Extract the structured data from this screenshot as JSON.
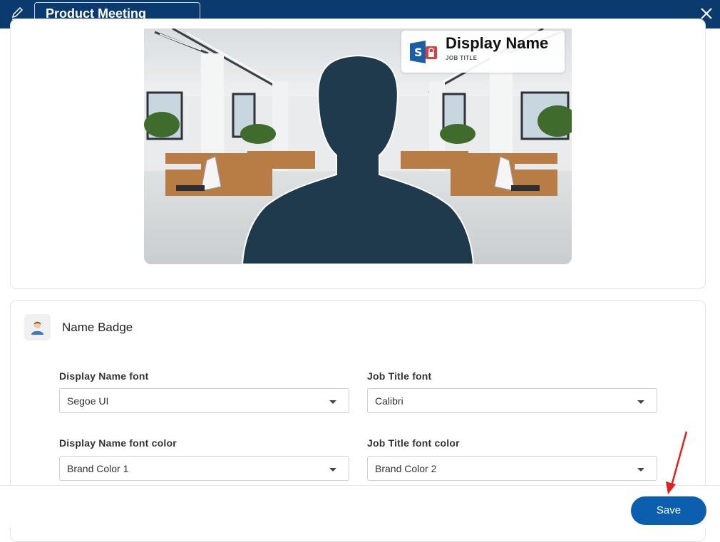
{
  "header": {
    "title": "Product Meeting"
  },
  "preview": {
    "badge": {
      "display_name": "Display Name",
      "job_title": "JOB TITLE"
    }
  },
  "name_badge": {
    "section_title": "Name Badge",
    "fields": {
      "display_name_font": {
        "label": "Display Name font",
        "value": "Segoe UI"
      },
      "job_title_font": {
        "label": "Job Title font",
        "value": "Calibri"
      },
      "display_name_font_color": {
        "label": "Display Name font color",
        "value": "Brand Color 1"
      },
      "job_title_font_color": {
        "label": "Job Title font color",
        "value": "Brand Color 2"
      }
    }
  },
  "footer": {
    "save_label": "Save"
  },
  "colors": {
    "header_bg": "#0b3a6e",
    "primary_button": "#0b5fae",
    "annotation_arrow": "#e0201c",
    "silhouette": "#1f3a4d"
  }
}
